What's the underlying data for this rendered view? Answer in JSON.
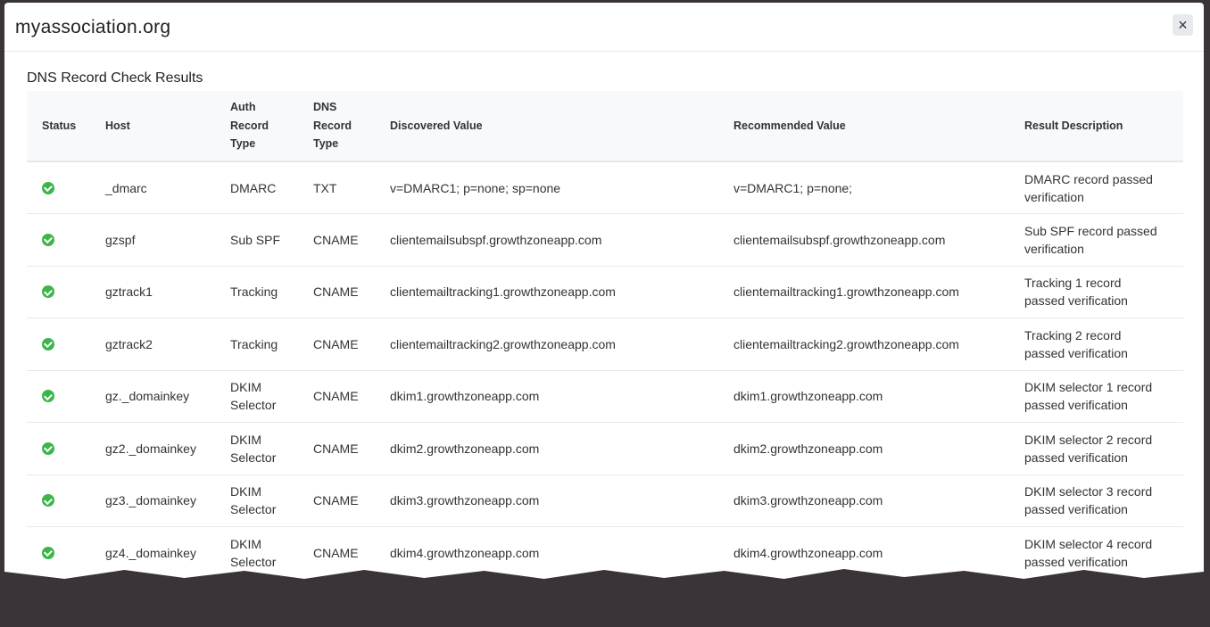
{
  "modal": {
    "title": "myassociation.org",
    "close": "×",
    "heading": "DNS Record Check Results"
  },
  "table": {
    "headers": [
      "Status",
      "Host",
      "Auth Record Type",
      "DNS Record Type",
      "Discovered Value",
      "Recommended Value",
      "Result Description"
    ],
    "rows": [
      {
        "host": "_dmarc",
        "auth": "DMARC",
        "dns": "TXT",
        "discovered": "v=DMARC1; p=none; sp=none",
        "recommended": "v=DMARC1; p=none;",
        "result": "DMARC record passed verification"
      },
      {
        "host": "gzspf",
        "auth": "Sub SPF",
        "dns": "CNAME",
        "discovered": "clientemailsubspf.growthzoneapp.com",
        "recommended": "clientemailsubspf.growthzoneapp.com",
        "result": "Sub SPF record passed verification"
      },
      {
        "host": "gztrack1",
        "auth": "Tracking",
        "dns": "CNAME",
        "discovered": "clientemailtracking1.growthzoneapp.com",
        "recommended": "clientemailtracking1.growthzoneapp.com",
        "result": "Tracking 1 record passed verification"
      },
      {
        "host": "gztrack2",
        "auth": "Tracking",
        "dns": "CNAME",
        "discovered": "clientemailtracking2.growthzoneapp.com",
        "recommended": "clientemailtracking2.growthzoneapp.com",
        "result": "Tracking 2 record passed verification"
      },
      {
        "host": "gz._domainkey",
        "auth": "DKIM Selector",
        "dns": "CNAME",
        "discovered": "dkim1.growthzoneapp.com",
        "recommended": "dkim1.growthzoneapp.com",
        "result": "DKIM selector 1 record passed verification"
      },
      {
        "host": "gz2._domainkey",
        "auth": "DKIM Selector",
        "dns": "CNAME",
        "discovered": "dkim2.growthzoneapp.com",
        "recommended": "dkim2.growthzoneapp.com",
        "result": "DKIM selector 2 record passed verification"
      },
      {
        "host": "gz3._domainkey",
        "auth": "DKIM Selector",
        "dns": "CNAME",
        "discovered": "dkim3.growthzoneapp.com",
        "recommended": "dkim3.growthzoneapp.com",
        "result": "DKIM selector 3 record passed verification"
      },
      {
        "host": "gz4._domainkey",
        "auth": "DKIM Selector",
        "dns": "CNAME",
        "discovered": "dkim4.growthzoneapp.com",
        "recommended": "dkim4.growthzoneapp.com",
        "result": "DKIM selector 4 record passed verification"
      }
    ]
  },
  "colors": {
    "success": "#3cb54a"
  }
}
